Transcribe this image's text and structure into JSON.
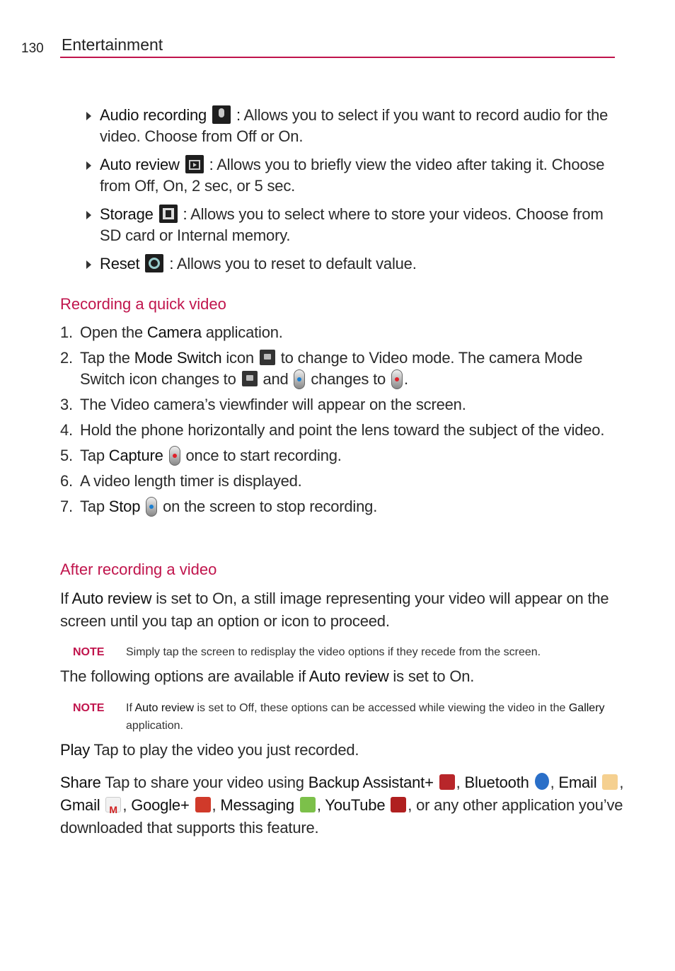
{
  "header": {
    "page_number": "130",
    "title": "Entertainment"
  },
  "colors": {
    "accent": "#c0144c"
  },
  "bullets": [
    {
      "term": "Audio recording",
      "icon": "microphone-icon",
      "sep": " :",
      "desc": " Allows you to select if you want to record audio for the video. Choose from Off or On."
    },
    {
      "term": "Auto review",
      "icon": "play-preview-icon",
      "sep": " :",
      "desc": " Allows you to briefly view the video after taking it. Choose from Off, On, 2 sec, or 5 sec."
    },
    {
      "term": "Storage",
      "icon": "sd-card-icon",
      "sep": " :",
      "desc": " Allows you to select where to store your videos. Choose from SD card or Internal memory."
    },
    {
      "term": "Reset",
      "icon": "reset-icon",
      "sep": " :",
      "desc": " Allows you to reset to default value."
    }
  ],
  "section1": {
    "heading": "Recording a quick video",
    "steps": [
      {
        "num": "1.",
        "parts": [
          "Open the ",
          "Camera",
          " application."
        ]
      },
      {
        "num": "2.",
        "parts": [
          "Tap the ",
          "Mode Switch",
          " icon ",
          " to change to Video mode. The camera Mode Switch icon changes to ",
          " and ",
          " changes to ",
          "."
        ]
      },
      {
        "num": "3.",
        "parts": [
          "The Video camera’s viewfinder will appear on the screen."
        ]
      },
      {
        "num": "4.",
        "parts": [
          "Hold the phone horizontally and point the lens toward the subject of the video."
        ]
      },
      {
        "num": "5.",
        "parts": [
          "Tap ",
          "Capture",
          " once to start recording."
        ]
      },
      {
        "num": "6.",
        "parts": [
          "A video length timer is displayed."
        ]
      },
      {
        "num": "7.",
        "parts": [
          "Tap ",
          "Stop",
          " on the screen to stop recording."
        ]
      }
    ]
  },
  "section2": {
    "heading": "After recording a video",
    "intro": [
      "If ",
      "Auto review",
      " is set to On, a still image representing your video will appear on the screen until you tap an option or icon to proceed."
    ],
    "note1": {
      "label": "NOTE",
      "text": "Simply tap the screen to redisplay the video options if they recede from the screen."
    },
    "options_line": [
      "The following options are available if ",
      "Auto review",
      " is set to On."
    ],
    "note2": {
      "label": "NOTE",
      "parts": [
        "If ",
        "Auto review",
        " is set to Off, these options can be accessed while viewing the video in the ",
        "Gallery",
        " application."
      ]
    },
    "play": {
      "term": "Play",
      "desc": " Tap to play the video you just recorded."
    },
    "share": {
      "term": "Share",
      "desc": " Tap to share your video using ",
      "apps": [
        "Backup Assistant+",
        "Bluetooth",
        "Email",
        "Gmail",
        "Google+",
        "Messaging",
        "YouTube"
      ],
      "tail": ", or any other application you’ve downloaded that supports this feature."
    }
  }
}
